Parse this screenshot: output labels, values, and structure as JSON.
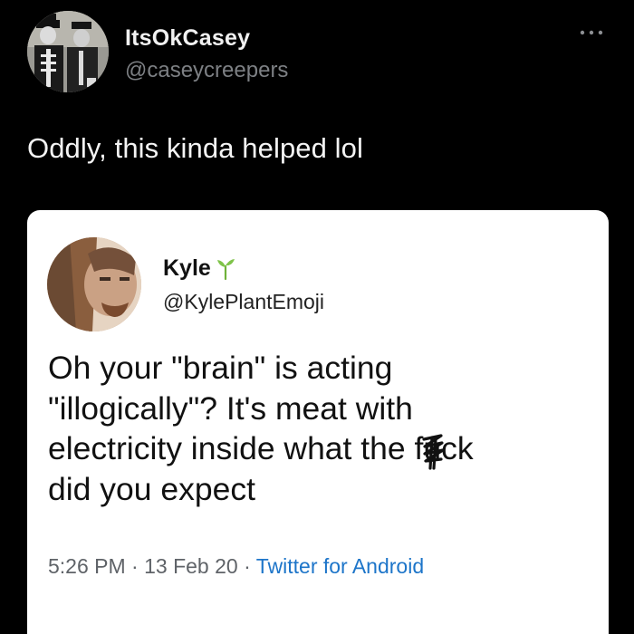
{
  "tweet": {
    "author": {
      "display_name": "ItsOkCasey",
      "handle": "@caseycreepers",
      "avatar_icon": "two-people-skeleton-costume-avatar"
    },
    "more_icon": "more-options-icon",
    "text": "Oddly, this kinda helped lol",
    "quoted": {
      "author": {
        "display_name": "Kyle",
        "handle": "@KylePlantEmoji",
        "badge_icon": "sprout-icon",
        "avatar_icon": "long-haired-man-avatar"
      },
      "text_lines": [
        "Oh your \"brain\" is acting",
        "\"illogically\"? It's meat with",
        "electricity inside what the f",
        "u",
        "ck",
        "did you expect"
      ],
      "time": "5:26 PM",
      "date": "13 Feb 20",
      "separator": "·",
      "source": "Twitter for Android"
    }
  },
  "colors": {
    "background": "#000000",
    "card": "#ffffff",
    "link": "#1d75c9",
    "muted": "#7d8084"
  }
}
